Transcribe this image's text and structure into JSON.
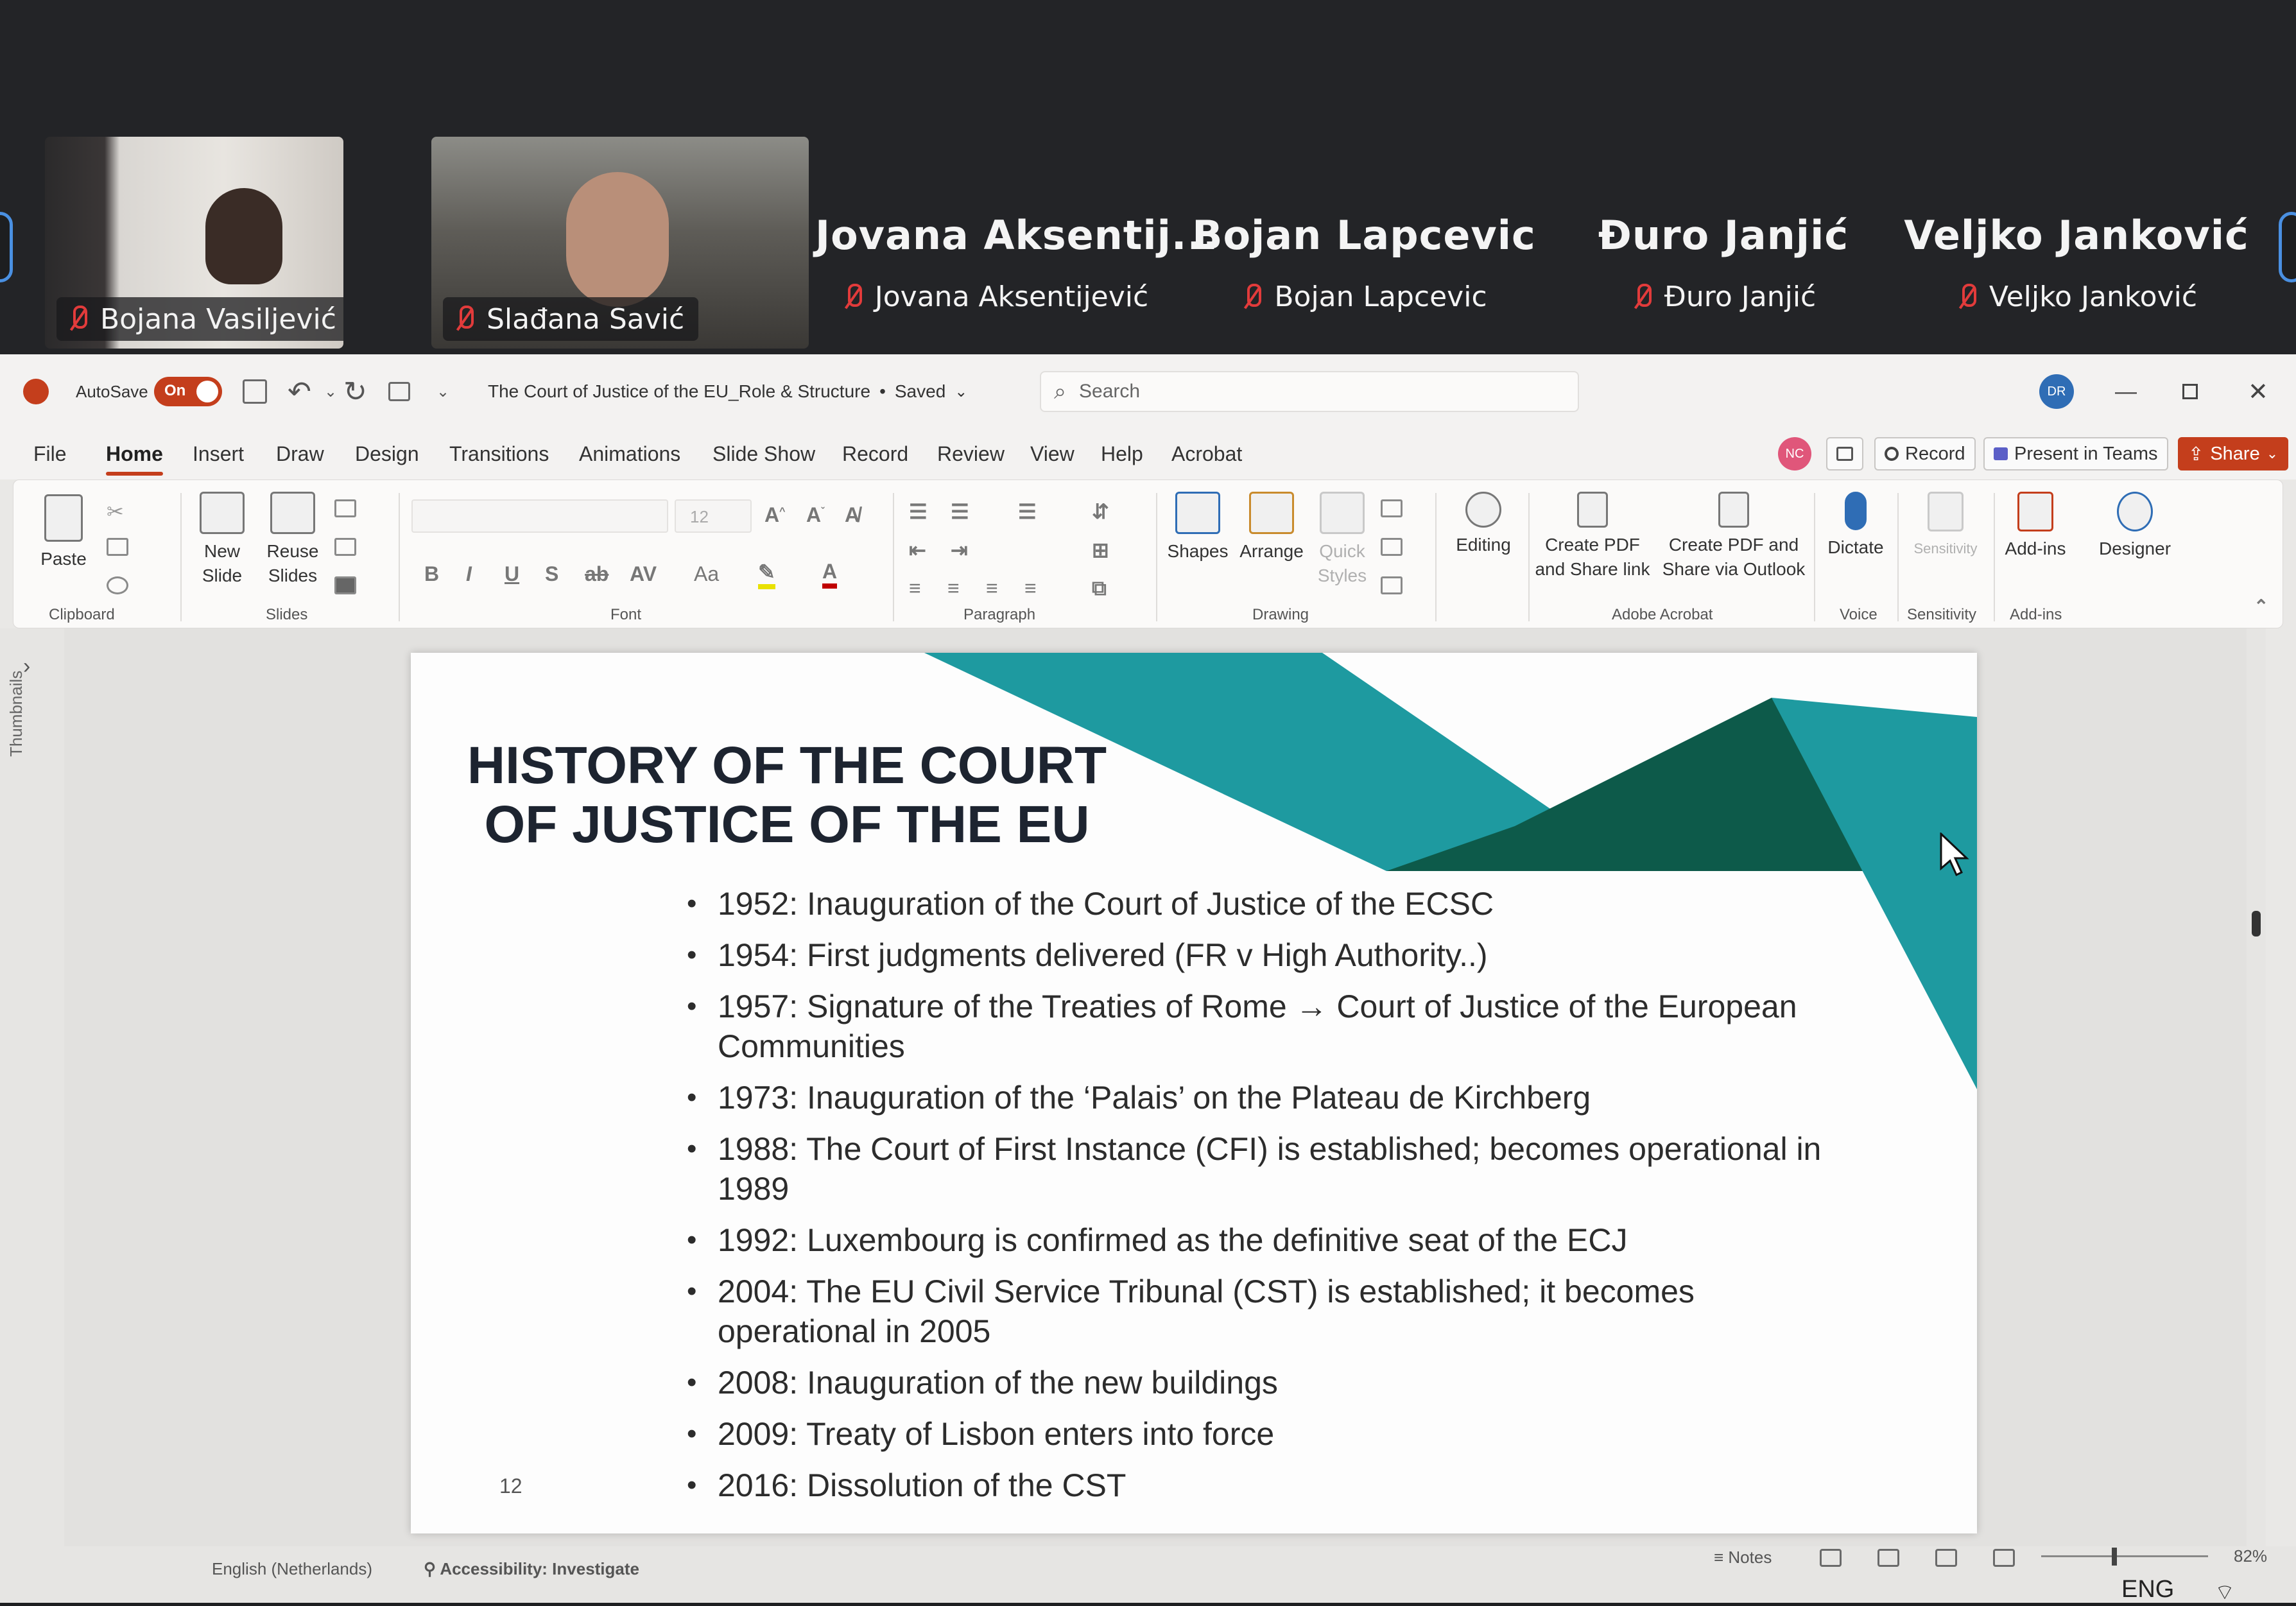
{
  "meeting": {
    "video_participants": [
      {
        "name": "Bojana Vasiljević"
      },
      {
        "name": "Slađana Savić"
      }
    ],
    "participants": [
      {
        "display": "Jovana  Aksentij...",
        "name": "Jovana Aksentijević"
      },
      {
        "display": "Bojan Lapcevic",
        "name": "Bojan Lapcevic"
      },
      {
        "display": "Đuro Janjić",
        "name": "Đuro Janjić"
      },
      {
        "display": "Veljko Janković",
        "name": "Veljko Janković"
      }
    ]
  },
  "powerpoint": {
    "titlebar": {
      "autosave_label": "AutoSave",
      "autosave_state": "On",
      "doc_title": "The Court of Justice of the EU_Role & Structure",
      "save_status": "Saved",
      "search_placeholder": "Search",
      "avatar_initials": "DR"
    },
    "menu": [
      "File",
      "Home",
      "Insert",
      "Draw",
      "Design",
      "Transitions",
      "Animations",
      "Slide Show",
      "Record",
      "Review",
      "View",
      "Help",
      "Acrobat"
    ],
    "active_menu": "Home",
    "top_buttons": {
      "user_initials": "NC",
      "record": "Record",
      "present_in_teams": "Present in Teams",
      "share": "Share"
    },
    "ribbon": {
      "paste": "Paste",
      "new_slide_1": "New",
      "new_slide_2": "Slide",
      "reuse_slides_1": "Reuse",
      "reuse_slides_2": "Slides",
      "font_size": "12",
      "shapes": "Shapes",
      "arrange": "Arrange",
      "quick_styles_1": "Quick",
      "quick_styles_2": "Styles",
      "editing": "Editing",
      "create_pdf_link_1": "Create PDF",
      "create_pdf_link_2": "and Share link",
      "create_pdf_outlook_1": "Create PDF and",
      "create_pdf_outlook_2": "Share via Outlook",
      "dictate": "Dictate",
      "sensitivity": "Sensitivity",
      "addins": "Add-ins",
      "designer": "Designer",
      "groups": {
        "clipboard": "Clipboard",
        "slides": "Slides",
        "font": "Font",
        "paragraph": "Paragraph",
        "drawing": "Drawing",
        "adobe_acrobat": "Adobe Acrobat",
        "voice": "Voice",
        "sensitivity": "Sensitivity",
        "addins": "Add-ins"
      }
    },
    "thumbnails_label": "Thumbnails",
    "slide": {
      "title_line1": "HISTORY OF THE COURT",
      "title_line2": "OF JUSTICE OF THE EU",
      "bullets": [
        "1952: Inauguration of the Court of Justice of the ECSC",
        "1954: First judgments delivered (FR v High Authority..)",
        "1957: Signature of the Treaties of Rome → Court of Justice of the European Communities",
        "1973: Inauguration of the ‘Palais’ on the Plateau de Kirchberg",
        "1988: The Court of First Instance (CFI) is established; becomes operational in 1989",
        "1992: Luxembourg is confirmed as the definitive seat of the ECJ",
        "2004: The EU Civil Service Tribunal (CST) is established; it becomes operational in 2005",
        "2008: Inauguration of the new buildings",
        "2009: Treaty of Lisbon enters into force",
        "2016: Dissolution of the CST"
      ],
      "number": "12",
      "colors": {
        "teal": "#1e9aa0",
        "dark_green": "#0d5a4a",
        "title": "#1d2430"
      }
    },
    "statusbar": {
      "language": "English (Netherlands)",
      "accessibility": "Accessibility: Investigate",
      "notes": "Notes",
      "zoom": "82%",
      "input_language": "ENG"
    }
  }
}
